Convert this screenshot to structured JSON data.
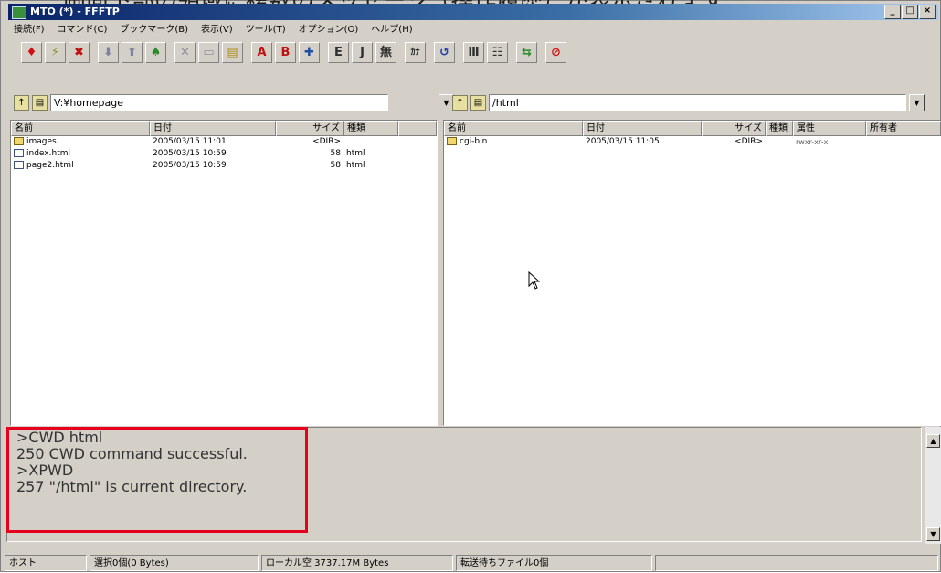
{
  "window": {
    "title": "MTO (*) - FFFTP",
    "controls": [
      "_",
      "□",
      "×"
    ]
  },
  "menu": [
    "接続(F)",
    "コマンド(C)",
    "ブックマーク(B)",
    "表示(V)",
    "ツール(T)",
    "オプション(O)",
    "ヘルプ(H)"
  ],
  "toolbar": {
    "buttons": [
      {
        "glyph": "♦",
        "color": "#d01010",
        "name": "connect-icon"
      },
      {
        "glyph": "⚡",
        "color": "#909030",
        "name": "quick-connect-icon"
      },
      {
        "glyph": "✖",
        "color": "#c01010",
        "name": "disconnect-icon"
      },
      {
        "glyph": "⬇",
        "color": "#8080a0",
        "name": "download-icon",
        "gap": true
      },
      {
        "glyph": "⬆",
        "color": "#8080a0",
        "name": "upload-icon"
      },
      {
        "glyph": "♠",
        "color": "#2a8a2a",
        "name": "mirror-upload-icon"
      },
      {
        "glyph": "✕",
        "color": "#9090a0",
        "name": "delete-icon",
        "gap": true
      },
      {
        "glyph": "▭",
        "color": "#9090a0",
        "name": "rename-icon"
      },
      {
        "glyph": "▤",
        "color": "#b09020",
        "name": "mkdir-icon"
      },
      {
        "glyph": "A",
        "color": "#c01010",
        "name": "ascii-mode-icon",
        "gap": true
      },
      {
        "glyph": "B",
        "color": "#c01010",
        "name": "binary-mode-icon"
      },
      {
        "glyph": "✚",
        "color": "#2050a0",
        "name": "auto-mode-icon"
      },
      {
        "glyph": "E",
        "color": "#303030",
        "name": "kanji-euc-icon",
        "gap": true
      },
      {
        "glyph": "J",
        "color": "#303030",
        "name": "kanji-jis-icon"
      },
      {
        "glyph": "無",
        "color": "#303030",
        "name": "kanji-none-icon"
      },
      {
        "glyph": "ｶﾅ",
        "color": "#303030",
        "name": "kana-convert-icon",
        "gap": true
      },
      {
        "glyph": "↺",
        "color": "#2040b0",
        "name": "refresh-icon",
        "gap": true
      },
      {
        "glyph": "Ⅲ",
        "color": "#303030",
        "name": "list-view-icon",
        "gap": true
      },
      {
        "glyph": "☷",
        "color": "#303030",
        "name": "detail-view-icon"
      },
      {
        "glyph": "⇆",
        "color": "#2a8a2a",
        "name": "sync-icon",
        "gap": true
      },
      {
        "glyph": "⊘",
        "color": "#d01010",
        "name": "stop-icon",
        "gap": true
      }
    ]
  },
  "local": {
    "path": "V:¥homepage",
    "columns": [
      "名前",
      "日付",
      "サイズ",
      "種類"
    ],
    "rows": [
      {
        "icon": "folder",
        "name": "images",
        "date": "2005/03/15 11:01",
        "size": "<DIR>",
        "type": ""
      },
      {
        "icon": "file",
        "name": "index.html",
        "date": "2005/03/15 10:59",
        "size": "58",
        "type": "html"
      },
      {
        "icon": "file",
        "name": "page2.html",
        "date": "2005/03/15 10:59",
        "size": "58",
        "type": "html"
      }
    ]
  },
  "remote": {
    "path": "/html",
    "columns": [
      "名前",
      "日付",
      "サイズ",
      "種類",
      "属性",
      "所有者"
    ],
    "rows": [
      {
        "icon": "folder",
        "name": "cgi-bin",
        "date": "2005/03/15 11:05",
        "size": "<DIR>",
        "type": "",
        "attr": "rwxr-xr-x",
        "owner": ""
      }
    ]
  },
  "log": [
    ">CWD html",
    "250 CWD command successful.",
    ">XPWD",
    "257 \"/html\" is current directory."
  ],
  "status": {
    "host": "ホスト",
    "selected": "選択0個(0 Bytes)",
    "local_free": "ローカル空 3737.17M Bytes",
    "queue": "転送待ちファイル0個"
  },
  "caption": "画面下部の領域に複数のメッセージ（操作履歴）が表示されます"
}
